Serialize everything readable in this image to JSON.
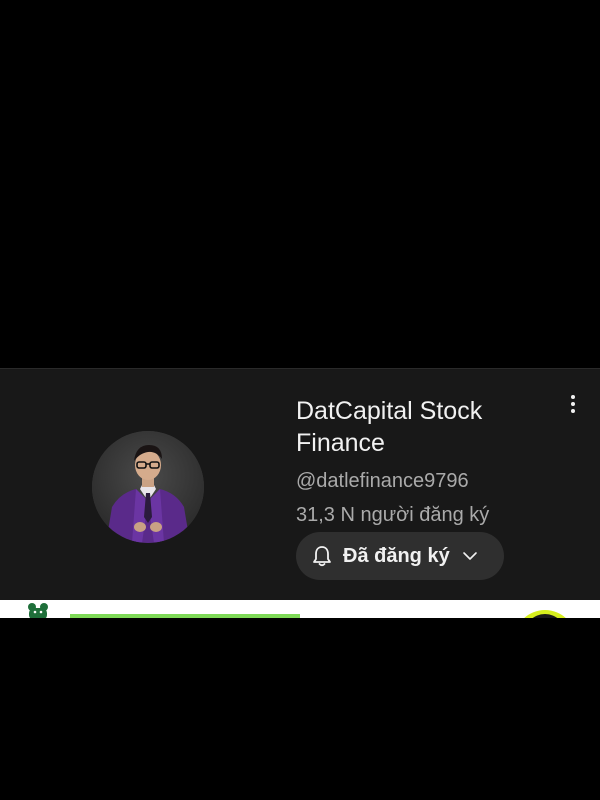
{
  "channel": {
    "name": "DatCapital Stock Finance",
    "handle": "@datlefinance9796",
    "subscribers": "31,3 N người đăng ký",
    "avatar_icon": "person-in-purple-suit-avatar"
  },
  "subscribe_button": {
    "label": "Đã đăng ký",
    "icon": "bell-icon",
    "dropdown_icon": "chevron-down-icon"
  },
  "menu": {
    "icon": "more-vertical-icon"
  },
  "colors": {
    "card_bg": "#181818",
    "button_bg": "#2f2f2f",
    "primary_text": "#f1f1f1",
    "secondary_text": "#aaaaaa",
    "accent_green": "#7ed957",
    "accent_yellow": "#d7ef1e"
  }
}
